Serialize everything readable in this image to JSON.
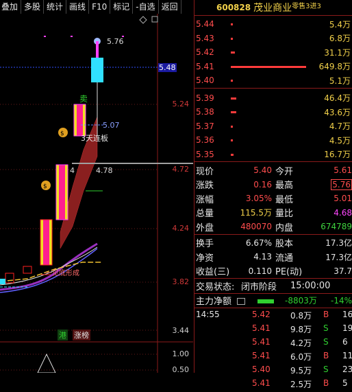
{
  "toolbar": [
    {
      "label": "叠加"
    },
    {
      "label": "多股"
    },
    {
      "label": "统计"
    },
    {
      "label": "画线"
    },
    {
      "label": "F10"
    },
    {
      "label": "标记"
    },
    {
      "label": "-自选"
    },
    {
      "label": "返回"
    }
  ],
  "chart": {
    "price_axis": [
      "5.48",
      "5.24",
      "4.72",
      "4.24",
      "3.82",
      "3.44"
    ],
    "volume_axis": [
      "1.00",
      "0.50"
    ],
    "annotations": {
      "high": "5.76",
      "level_507": "5.07",
      "level_478": "4.78",
      "level_4": "4",
      "sell": "卖",
      "three_limit": "3天连板",
      "chip_note": "一见底形成",
      "badge_hk": "港",
      "badge_limit": "涨榜"
    },
    "colors": {
      "up": "#ff2020",
      "cross": "#ff40ff",
      "yellow": "#f0e020",
      "cyan": "#30e0ff",
      "ribbon": "#8a1f1f"
    }
  },
  "stock": {
    "code": "600828",
    "name": "茂业商业",
    "tag": "零售3进3"
  },
  "asks": [
    {
      "price": "5.44",
      "vol": "5.4万",
      "bar": 0.01
    },
    {
      "price": "5.43",
      "vol": "6.8万",
      "bar": 0.01
    },
    {
      "price": "5.42",
      "vol": "31.1万",
      "bar": 0.05
    },
    {
      "price": "5.41",
      "vol": "649.8万",
      "bar": 1.0
    },
    {
      "price": "5.40",
      "vol": "5.1万",
      "bar": 0.01
    }
  ],
  "bids": [
    {
      "price": "5.39",
      "vol": "46.4万",
      "bar": 0.07
    },
    {
      "price": "5.38",
      "vol": "43.6万",
      "bar": 0.07
    },
    {
      "price": "5.37",
      "vol": "4.7万",
      "bar": 0.01
    },
    {
      "price": "5.36",
      "vol": "4.5万",
      "bar": 0.01
    },
    {
      "price": "5.35",
      "vol": "16.7万",
      "bar": 0.03
    }
  ],
  "quote": [
    {
      "l1": "现价",
      "v1": "5.40",
      "l2": "今开",
      "v2": "5.61"
    },
    {
      "l1": "涨跌",
      "v1": "0.16",
      "l2": "最高",
      "v2": "5.76"
    },
    {
      "l1": "涨幅",
      "v1": "3.05%",
      "l2": "最低",
      "v2": "5.01"
    },
    {
      "l1": "总量",
      "v1": "115.5万",
      "l2": "量比",
      "v2": "4.68"
    },
    {
      "l1": "外盘",
      "v1": "480070",
      "l2": "内盘",
      "v2": "674789"
    }
  ],
  "quote2": [
    {
      "l1": "换手",
      "v1": "6.67%",
      "l2": "股本",
      "v2": "17.3亿"
    },
    {
      "l1": "净资",
      "v1": "4.13",
      "l2": "流通",
      "v2": "17.3亿"
    },
    {
      "l1": "收益(三)",
      "v1": "0.110",
      "l2": "PE(动)",
      "v2": "37.7"
    }
  ],
  "trade_status": {
    "label": "交易状态:",
    "value": "闭市阶段",
    "time": "15:00:00"
  },
  "main_flow": {
    "label": "主力净额",
    "value": "-8803万",
    "pct": "-14%"
  },
  "ticks": [
    {
      "time": "14:55",
      "price": "5.42",
      "vol": "0.8万",
      "side": "B",
      "n": "16"
    },
    {
      "time": "",
      "price": "5.41",
      "vol": "9.8万",
      "side": "S",
      "n": "19"
    },
    {
      "time": "",
      "price": "5.41",
      "vol": "4.2万",
      "side": "S",
      "n": "6"
    },
    {
      "time": "",
      "price": "5.41",
      "vol": "6.0万",
      "side": "B",
      "n": "11"
    },
    {
      "time": "",
      "price": "5.40",
      "vol": "9.5万",
      "side": "S",
      "n": "23"
    },
    {
      "time": "",
      "price": "5.41",
      "vol": "2.5万",
      "side": "B",
      "n": "5"
    }
  ]
}
